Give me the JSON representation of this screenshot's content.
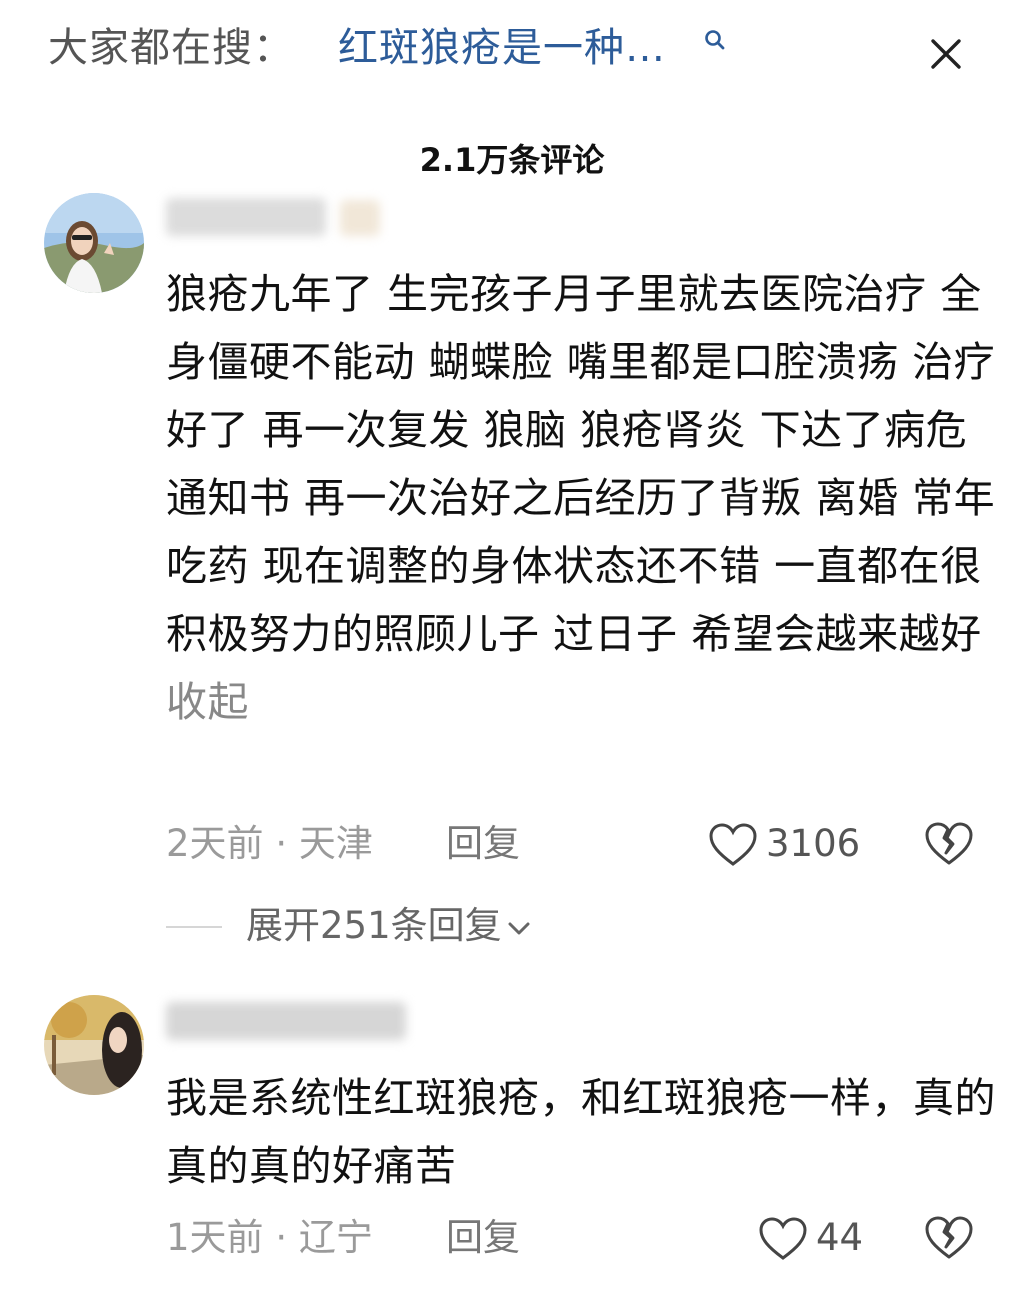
{
  "search": {
    "prefix": "大家都在搜：",
    "term": "红斑狼疮是一种…",
    "icon": "search-icon",
    "close_icon": "close-icon",
    "term_color": "#2d5c99"
  },
  "header": {
    "title": "2.1万条评论"
  },
  "comments": [
    {
      "text": "狼疮九年了 生完孩子月子里就去医院治疗 全身僵硬不能动 蝴蝶脸 嘴里都是口腔溃疡 治疗好了 再一次复发 狼脑 狼疮肾炎 下达了病危通知书 再一次治好之后经历了背叛 离婚 常年吃药 现在调整的身体状态还不错 一直都在很积极努力的照顾儿子 过日子 希望会越来越好",
      "collapse_label": "收起",
      "time": "2天前",
      "location": "天津",
      "reply_label": "回复",
      "like_count": "3106",
      "expand_label": "展开251条回复"
    },
    {
      "text": "我是系统性红斑狼疮，和红斑狼疮一样，真的真的真的好痛苦",
      "time": "1天前",
      "location": "辽宁",
      "reply_label": "回复",
      "like_count": "44"
    }
  ]
}
